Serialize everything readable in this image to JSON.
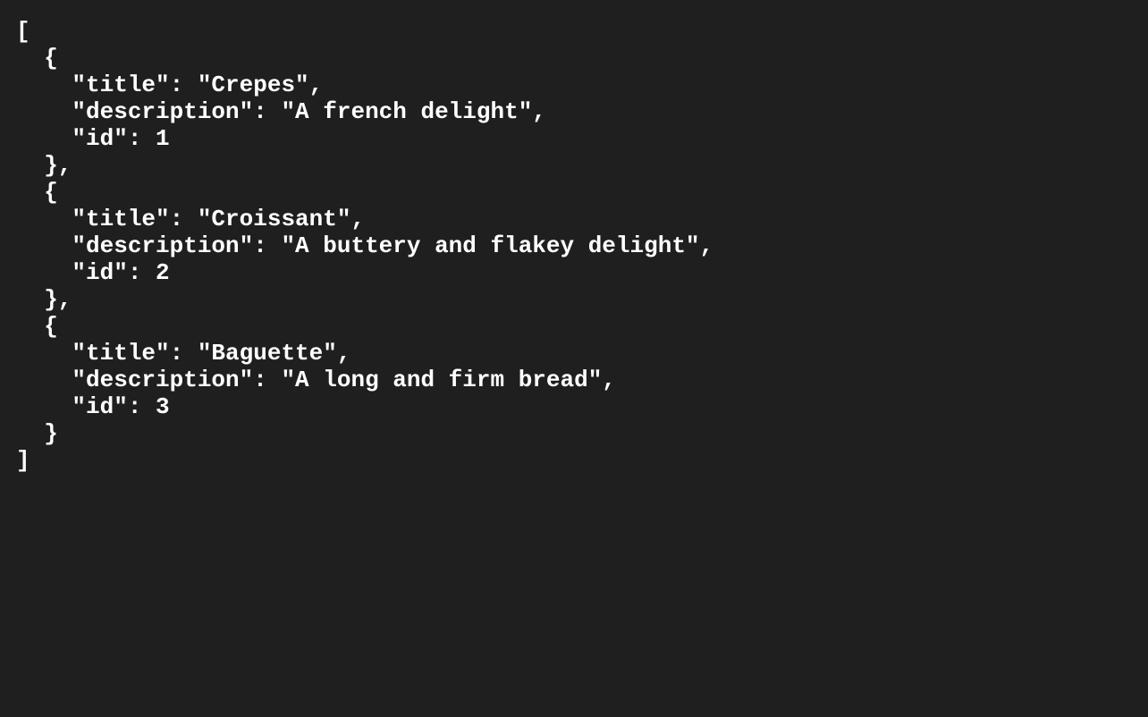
{
  "json_lines": [
    "[",
    "  {",
    "    \"title\": \"Crepes\",",
    "    \"description\": \"A french delight\",",
    "    \"id\": 1",
    "  },",
    "  {",
    "    \"title\": \"Croissant\",",
    "    \"description\": \"A buttery and flakey delight\",",
    "    \"id\": 2",
    "  },",
    "  {",
    "    \"title\": \"Baguette\",",
    "    \"description\": \"A long and firm bread\",",
    "    \"id\": 3",
    "  }",
    "]"
  ]
}
